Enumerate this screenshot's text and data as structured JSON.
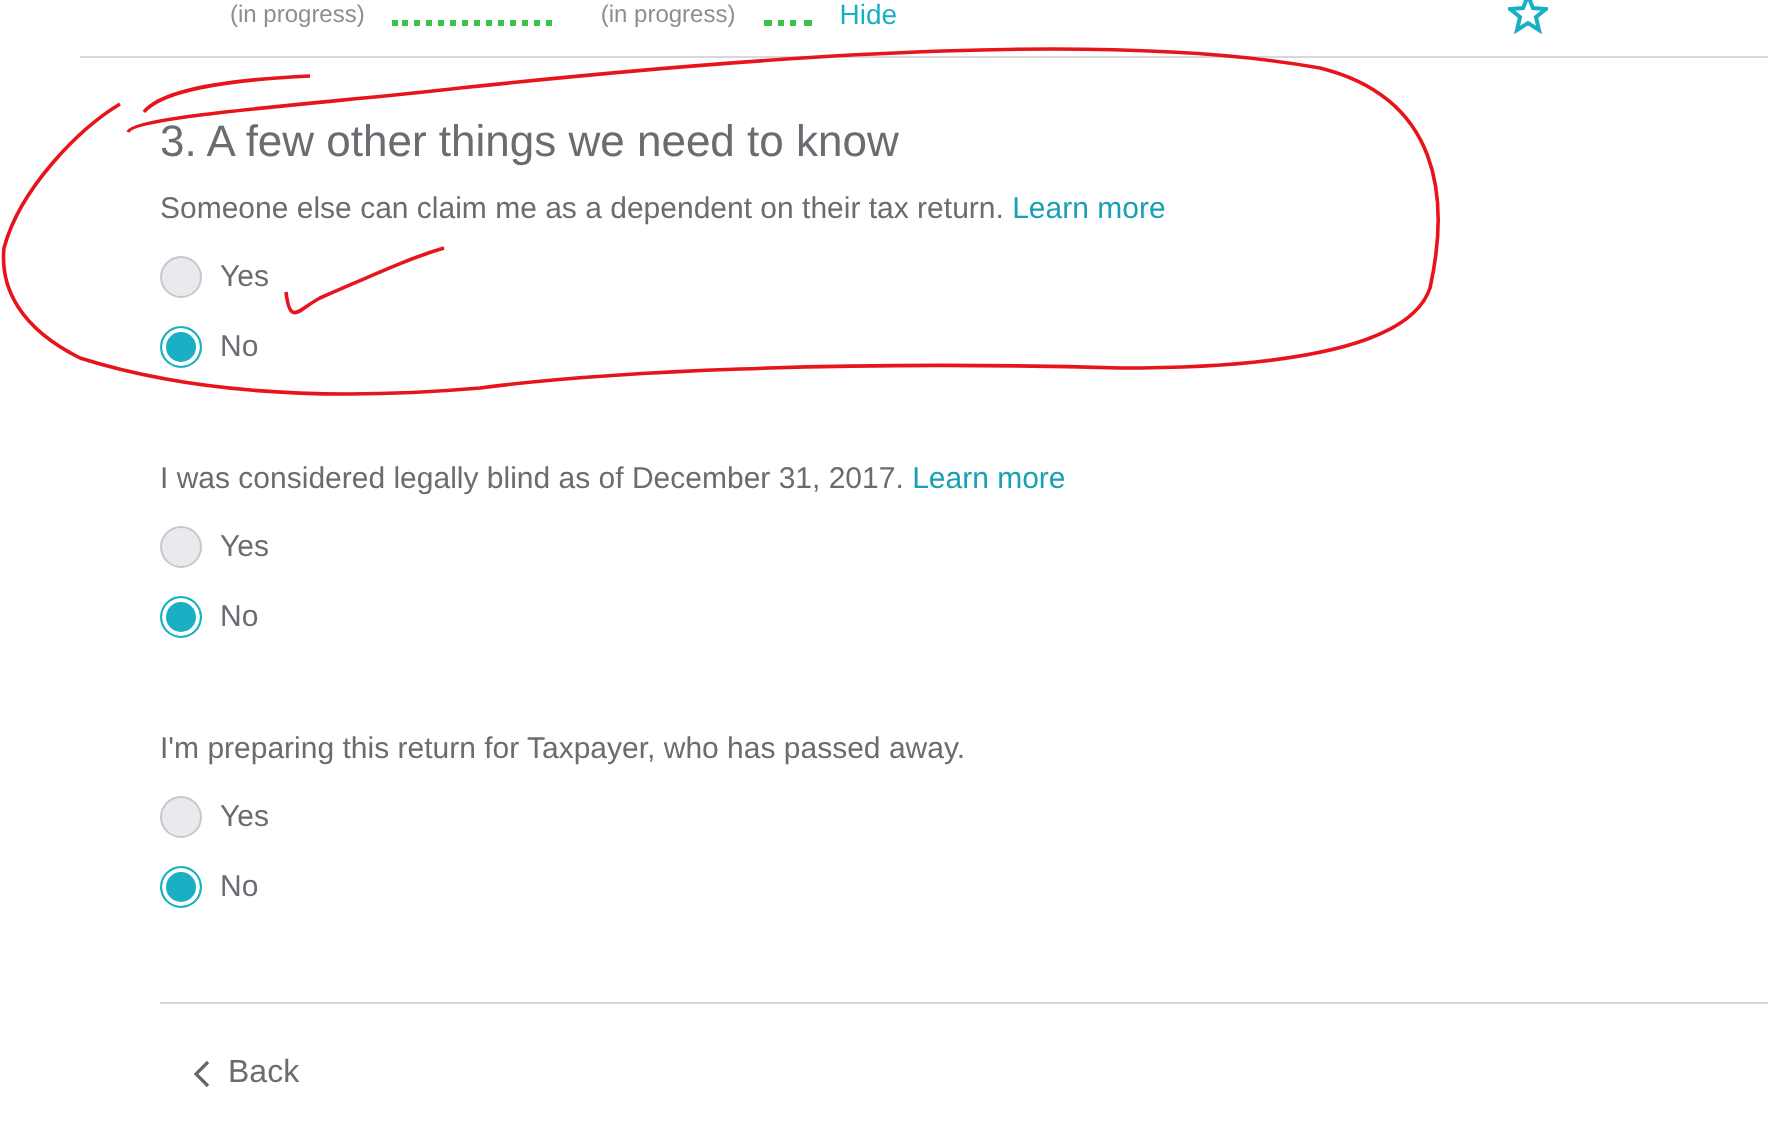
{
  "summary_bar": {
    "statuses": [
      "(in progress)",
      "(in progress)"
    ],
    "hide_link": "Hide"
  },
  "section": {
    "title": "3. A few other things we need to know",
    "questions": [
      {
        "text": "Someone else can claim me as a dependent on their tax return.",
        "link": "Learn more",
        "options": [
          {
            "label": "Yes",
            "selected": false
          },
          {
            "label": "No",
            "selected": true
          }
        ]
      },
      {
        "text": "I was considered legally blind as of December 31, 2017.",
        "link": "Learn more",
        "options": [
          {
            "label": "Yes",
            "selected": false
          },
          {
            "label": "No",
            "selected": true
          }
        ]
      },
      {
        "text": "I'm preparing this return for Taxpayer, who has passed away.",
        "options": [
          {
            "label": "Yes",
            "selected": false
          },
          {
            "label": "No",
            "selected": true
          }
        ]
      }
    ]
  },
  "back_button": "Back"
}
